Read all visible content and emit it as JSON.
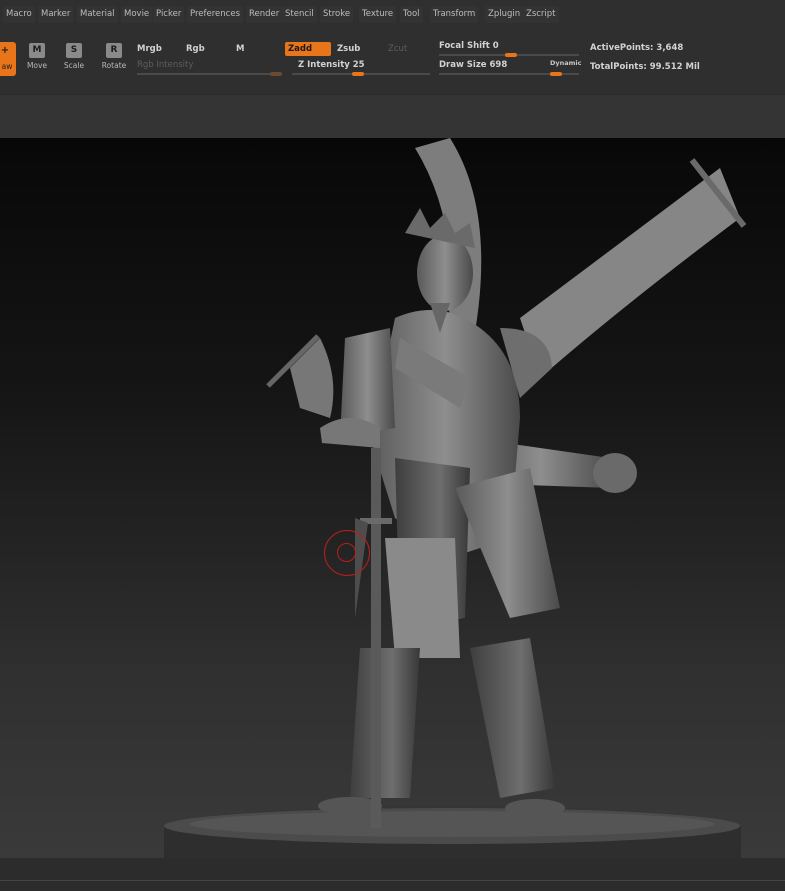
{
  "menu": {
    "items": [
      "Macro",
      "Marker",
      "Material",
      "Movie",
      "Picker",
      "Preferences",
      "Render",
      "Stencil",
      "Stroke",
      "Texture",
      "Tool",
      "Transform",
      "Zplugin",
      "Zscript"
    ]
  },
  "toolbar": {
    "draw_label": "aw",
    "move_label": "Move",
    "scale_label": "Scale",
    "rotate_label": "Rotate",
    "move_glyph": "M",
    "scale_glyph": "S",
    "rotate_glyph": "R",
    "mrgb_label": "Mrgb",
    "rgb_label": "Rgb",
    "m_label": "M",
    "rgb_intensity_label": "Rgb Intensity",
    "zadd_label": "Zadd",
    "zsub_label": "Zsub",
    "zcut_label": "Zcut",
    "z_intensity_label": "Z Intensity 25",
    "focal_shift_label": "Focal Shift 0",
    "draw_size_label": "Draw Size 698",
    "dynamic_label": "Dynamic",
    "active_points_label": "ActivePoints: 3,648",
    "total_points_label": "TotalPoints: 99.512 Mil"
  },
  "colors": {
    "accent": "#e8751a",
    "brush_cursor": "#b81f1f"
  }
}
